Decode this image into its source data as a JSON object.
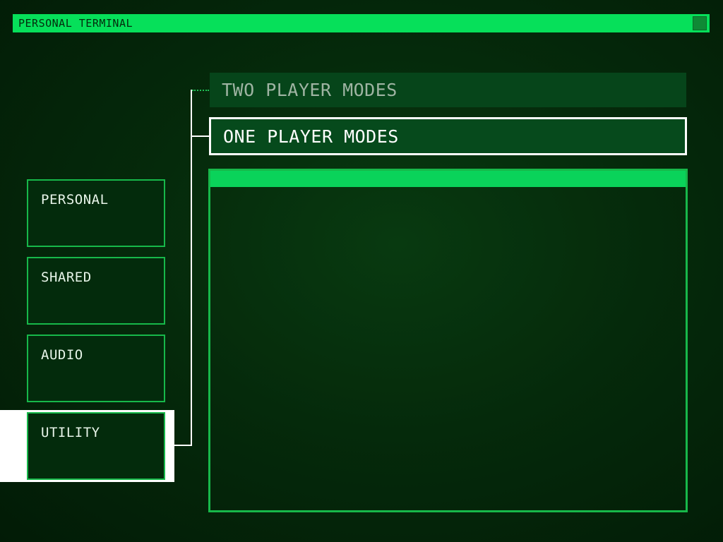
{
  "window": {
    "title": "PERSONAL TERMINAL",
    "close_icon": "square-close-icon"
  },
  "menu": {
    "items": [
      {
        "label": "PERSONAL",
        "selected": false
      },
      {
        "label": "SHARED",
        "selected": false
      },
      {
        "label": "AUDIO",
        "selected": false
      },
      {
        "label": "UTILITY",
        "selected": true
      }
    ]
  },
  "modes": {
    "two_player": "TWO PLAYER MODES",
    "one_player": "ONE PLAYER MODES",
    "selected": "ONE PLAYER MODES"
  },
  "colors": {
    "accent": "#06e05a",
    "background": "#021b06",
    "border": "#17b84a",
    "text": "#e8f5ea",
    "muted_text": "#9fb4a3",
    "highlight": "#ffffff"
  }
}
